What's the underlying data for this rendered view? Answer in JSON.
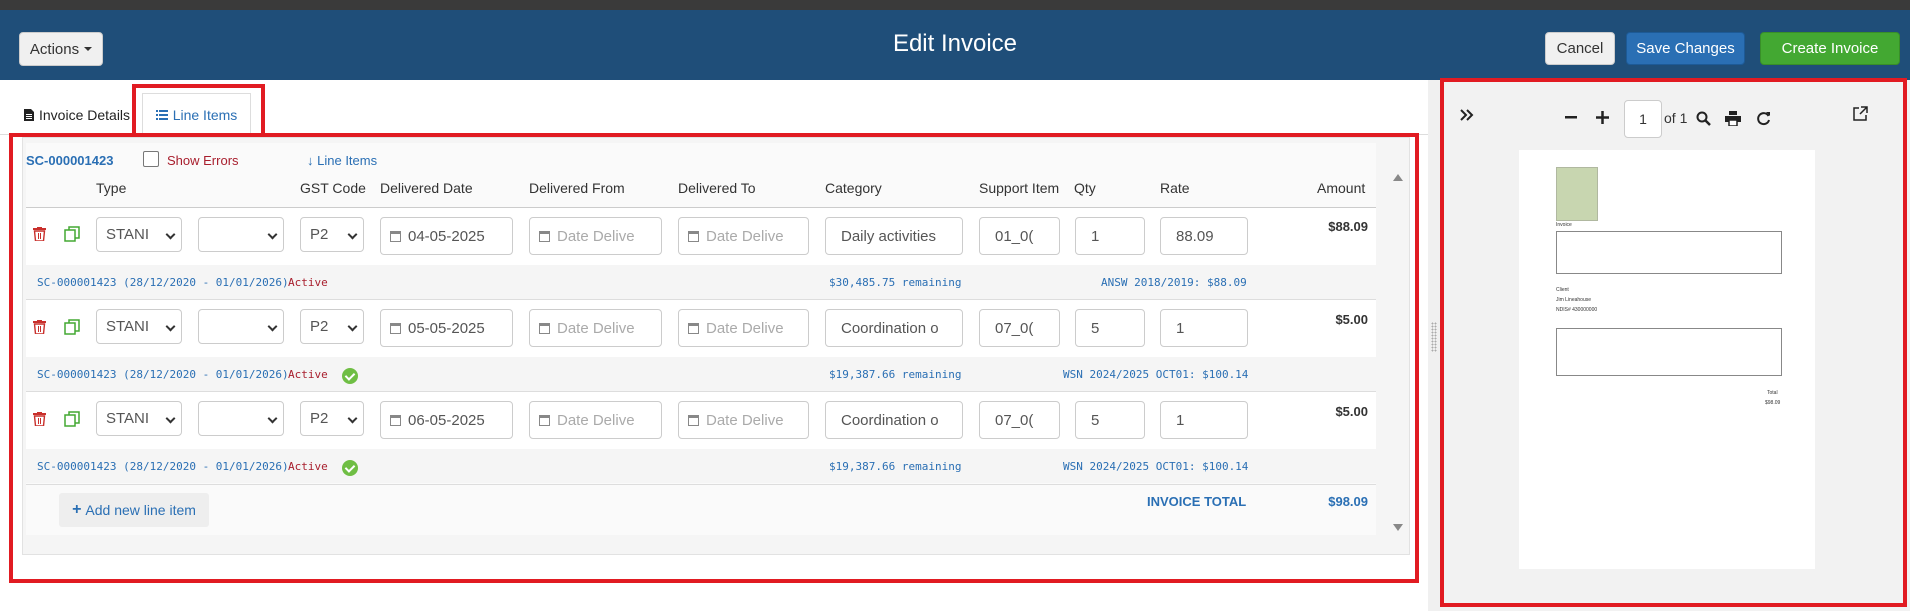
{
  "header": {
    "actions_label": "Actions",
    "title": "Edit Invoice",
    "cancel_label": "Cancel",
    "save_label": "Save Changes",
    "create_label": "Create Invoice"
  },
  "tabs": [
    {
      "label": "Invoice Details"
    },
    {
      "label": "Line Items"
    }
  ],
  "toolbar": {
    "sc_id": "SC-000001423",
    "show_errors_label": "Show Errors",
    "line_items_link": "Line Items"
  },
  "columns": [
    "Type",
    "GST Code",
    "Delivered Date",
    "Delivered From",
    "Delivered To",
    "Category",
    "Support Item",
    "Qty",
    "Rate",
    "Amount"
  ],
  "rows": [
    {
      "type": "STANI",
      "type2": "",
      "gst": "P2",
      "delivered_date": "04-05-2025",
      "delivered_from_placeholder": "Date Delive",
      "delivered_to_placeholder": "Date Delive",
      "category": "Daily activities",
      "support_item": "01_0(",
      "qty": "1",
      "rate": "88.09",
      "amount": "$88.09",
      "meta_sc": "SC-000001423 (28/12/2020 - 01/01/2026)",
      "meta_status": "Active",
      "meta_ok": false,
      "meta_remaining": "$30,485.75 remaining",
      "meta_price": "ANSW 2018/2019: $88.09"
    },
    {
      "type": "STANI",
      "type2": "",
      "gst": "P2",
      "delivered_date": "05-05-2025",
      "delivered_from_placeholder": "Date Delive",
      "delivered_to_placeholder": "Date Delive",
      "category": "Coordination o",
      "support_item": "07_0(",
      "qty": "5",
      "rate": "1",
      "amount": "$5.00",
      "meta_sc": "SC-000001423 (28/12/2020 - 01/01/2026)",
      "meta_status": "Active",
      "meta_ok": true,
      "meta_remaining": "$19,387.66 remaining",
      "meta_price": "WSN 2024/2025 OCT01: $100.14"
    },
    {
      "type": "STANI",
      "type2": "",
      "gst": "P2",
      "delivered_date": "06-05-2025",
      "delivered_from_placeholder": "Date Delive",
      "delivered_to_placeholder": "Date Delive",
      "category": "Coordination o",
      "support_item": "07_0(",
      "qty": "5",
      "rate": "1",
      "amount": "$5.00",
      "meta_sc": "SC-000001423 (28/12/2020 - 01/01/2026)",
      "meta_status": "Active",
      "meta_ok": true,
      "meta_remaining": "$19,387.66 remaining",
      "meta_price": "WSN 2024/2025 OCT01: $100.14"
    }
  ],
  "footer": {
    "add_label": "Add new line item",
    "total_label": "INVOICE TOTAL",
    "total_value": "$98.09"
  },
  "preview": {
    "page": "1",
    "of_label": "of 1"
  },
  "colors": {
    "header_bg": "#1f4e79",
    "link_blue": "#2a6fb4",
    "status_red": "#a81e2d",
    "create_green": "#43a832",
    "highlight_red": "#e11b22"
  }
}
